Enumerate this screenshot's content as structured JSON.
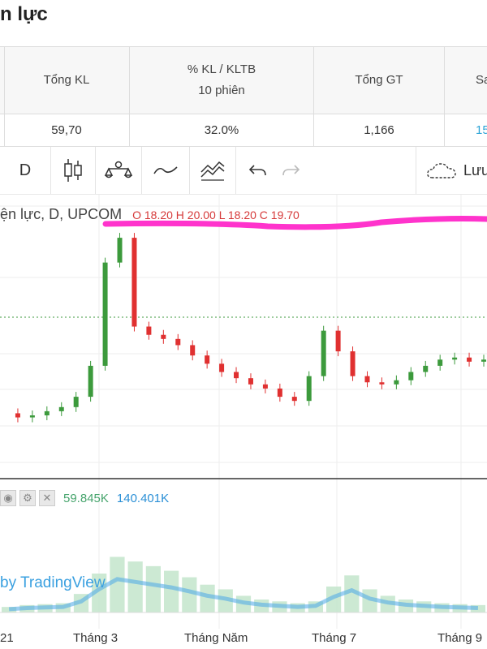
{
  "page_title": "n lực",
  "stats": {
    "columns": [
      {
        "header_line1": "Tổng KL",
        "header_line2": "",
        "value": "59,70"
      },
      {
        "header_line1": "% KL / KLTB",
        "header_line2": "10 phiên",
        "value": "32.0%"
      },
      {
        "header_line1": "Tổng GT",
        "header_line2": "",
        "value": "1,166"
      },
      {
        "header_line1": "Sa",
        "header_line2": "",
        "value": "15"
      }
    ]
  },
  "toolbar": {
    "interval": "D",
    "candles_icon": "candlestick-icon",
    "indicators_icon": "indicators-icon",
    "line_icon": "line-chart-icon",
    "area_icon": "area-chart-icon",
    "undo_icon": "undo-icon",
    "redo_icon": "redo-icon",
    "save_label": "Lưu"
  },
  "chart": {
    "legend_title": "ện lực, D, UPCOM",
    "ohlc_text": "O 18.20 H 20.00 L 18.20 C 19.70",
    "volume_value1": "59.845K",
    "volume_value2": "140.401K",
    "watermark": "by TradingView",
    "x_labels": [
      "21",
      "Tháng 3",
      "Tháng Năm",
      "Tháng 7",
      "Tháng 9"
    ],
    "colors": {
      "up": "#3c9a3c",
      "down": "#e03030",
      "annotation": "#ff33cc",
      "volume_line": "#4aa8e8"
    }
  },
  "chart_data": {
    "type": "candlestick",
    "x": [
      "Tháng 3",
      "Tháng Năm",
      "Tháng 7",
      "Tháng 9"
    ],
    "series": [
      {
        "values": [
          11.2,
          11.0,
          11.1,
          11.3,
          11.5,
          12.0,
          13.5,
          18.5,
          19.7,
          15.4,
          15.0,
          14.8,
          14.5,
          14.0,
          13.6,
          13.2,
          12.9,
          12.6,
          12.4,
          12.0,
          11.8,
          13.0,
          15.2,
          14.2,
          13.0,
          12.7,
          12.6,
          12.8,
          13.2,
          13.5,
          13.8,
          13.9,
          13.7,
          13.8
        ]
      }
    ],
    "volume": [
      6,
      8,
      9,
      10,
      20,
      42,
      60,
      55,
      50,
      45,
      38,
      30,
      25,
      18,
      14,
      12,
      10,
      12,
      28,
      40,
      25,
      18,
      14,
      12,
      10,
      9,
      8
    ]
  }
}
